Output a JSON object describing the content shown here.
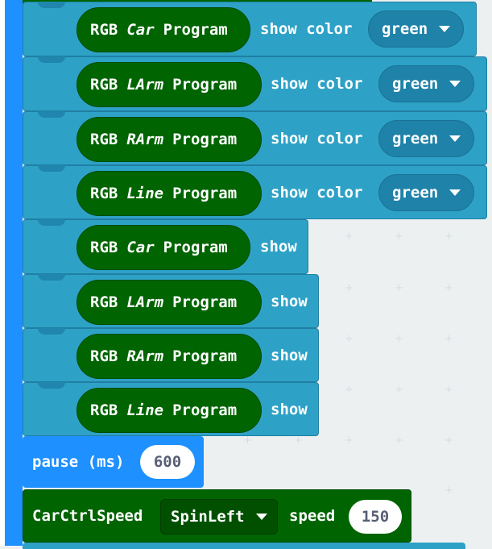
{
  "rgb_color_blocks": [
    {
      "prefix": "RGB",
      "target": "Car",
      "suffix": "Program",
      "action": "show color",
      "value": "green"
    },
    {
      "prefix": "RGB",
      "target": "LArm",
      "suffix": "Program",
      "action": "show color",
      "value": "green"
    },
    {
      "prefix": "RGB",
      "target": "RArm",
      "suffix": "Program",
      "action": "show color",
      "value": "green"
    },
    {
      "prefix": "RGB",
      "target": "Line",
      "suffix": "Program",
      "action": "show color",
      "value": "green"
    }
  ],
  "rgb_show_blocks": [
    {
      "prefix": "RGB",
      "target": "Car",
      "suffix": "Program",
      "action": "show"
    },
    {
      "prefix": "RGB",
      "target": "LArm",
      "suffix": "Program",
      "action": "show"
    },
    {
      "prefix": "RGB",
      "target": "RArm",
      "suffix": "Program",
      "action": "show"
    },
    {
      "prefix": "RGB",
      "target": "Line",
      "suffix": "Program",
      "action": "show"
    }
  ],
  "pause": {
    "label": "pause (ms)",
    "value": "600"
  },
  "car_ctrl": {
    "label": "CarCtrlSpeed",
    "mode": "SpinLeft",
    "speed_label": "speed",
    "speed": "150"
  },
  "colors": {
    "rgb_block": "#2ea1c6",
    "program_pill": "#006400",
    "pause_block": "#1e90ff"
  }
}
